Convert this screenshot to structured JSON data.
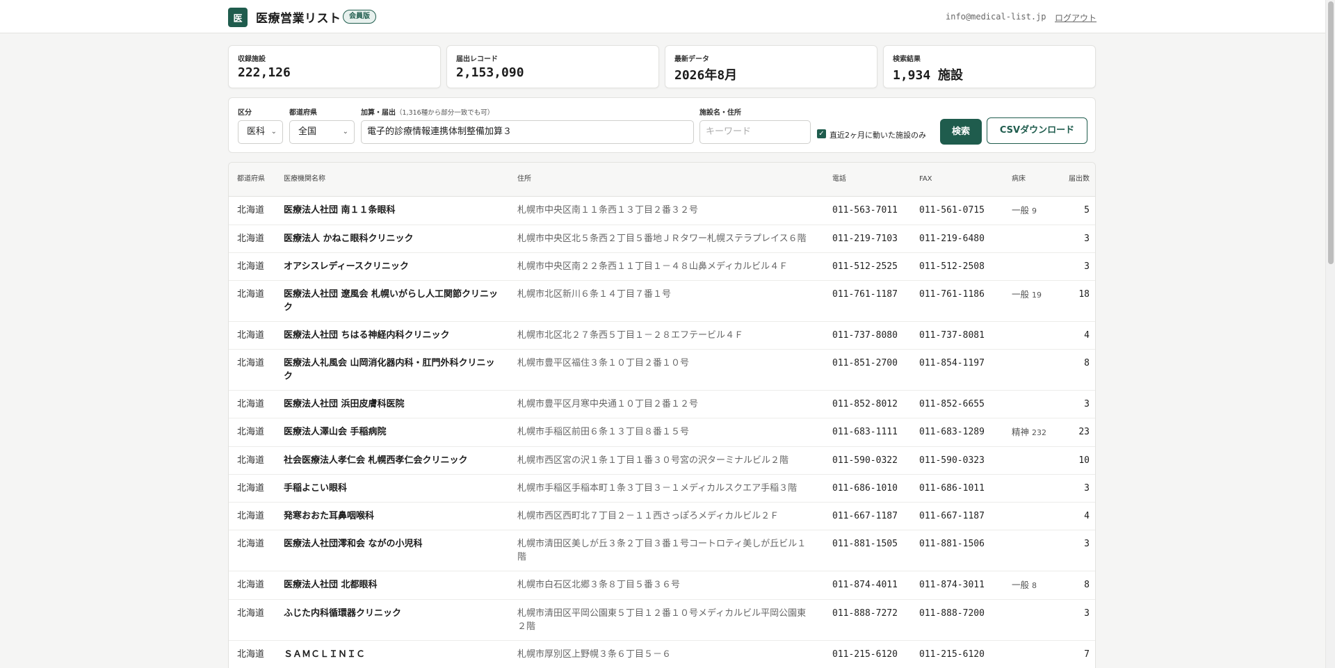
{
  "header": {
    "logo_glyph": "医",
    "title": "医療営業リスト",
    "badge": "会員版",
    "email": "info@medical-list.jp",
    "logout": "ログアウト"
  },
  "stats": [
    {
      "label": "収録施設",
      "value": "222,126"
    },
    {
      "label": "届出レコード",
      "value": "2,153,090"
    },
    {
      "label": "最新データ",
      "value": "2026年8月"
    },
    {
      "label": "検索結果",
      "value": "1,934 施設"
    }
  ],
  "filters": {
    "category_label": "区分",
    "category_value": "医科",
    "prefecture_label": "都道府県",
    "prefecture_value": "全国",
    "addition_label": "加算・届出",
    "addition_hint": "（1,316種から部分一致でも可）",
    "addition_value": "電子的診療情報連携体制整備加算３",
    "keyword_label": "施設名・住所",
    "keyword_placeholder": "キーワード",
    "recent_only_label": "直近2ヶ月に動いた施設のみ",
    "recent_only_checked": true,
    "search_button": "検索",
    "csv_button": "CSVダウンロード"
  },
  "table": {
    "headers": {
      "pref": "都道府県",
      "name": "医療機関名称",
      "address": "住所",
      "tel": "電話",
      "fax": "FAX",
      "beds": "病床",
      "count": "届出数"
    },
    "rows": [
      {
        "pref": "北海道",
        "name": "医療法人社団 南１１条眼科",
        "address": "札幌市中央区南１１条西１３丁目２番３２号",
        "tel": "011-563-7011",
        "fax": "011-561-0715",
        "bed_type": "一般",
        "bed_num": "9",
        "count": "5"
      },
      {
        "pref": "北海道",
        "name": "医療法人 かねこ眼科クリニック",
        "address": "札幌市中央区北５条西２丁目５番地ＪＲタワー札幌ステラプレイス６階",
        "tel": "011-219-7103",
        "fax": "011-219-6480",
        "bed_type": "",
        "bed_num": "",
        "count": "3"
      },
      {
        "pref": "北海道",
        "name": "オアシスレディースクリニック",
        "address": "札幌市中央区南２２条西１１丁目１－４８山鼻メディカルビル４Ｆ",
        "tel": "011-512-2525",
        "fax": "011-512-2508",
        "bed_type": "",
        "bed_num": "",
        "count": "3"
      },
      {
        "pref": "北海道",
        "name": "医療法人社団 遼風会 札幌いがらし人工関節クリニック",
        "address": "札幌市北区新川６条１４丁目７番１号",
        "tel": "011-761-1187",
        "fax": "011-761-1186",
        "bed_type": "一般",
        "bed_num": "19",
        "count": "18"
      },
      {
        "pref": "北海道",
        "name": "医療法人社団 ちはる神経内科クリニック",
        "address": "札幌市北区北２７条西５丁目１－２８エフテービル４Ｆ",
        "tel": "011-737-8080",
        "fax": "011-737-8081",
        "bed_type": "",
        "bed_num": "",
        "count": "4"
      },
      {
        "pref": "北海道",
        "name": "医療法人礼風会 山岡消化器内科・肛門外科クリニック",
        "address": "札幌市豊平区福住３条１０丁目２番１０号",
        "tel": "011-851-2700",
        "fax": "011-854-1197",
        "bed_type": "",
        "bed_num": "",
        "count": "8"
      },
      {
        "pref": "北海道",
        "name": "医療法人社団 浜田皮膚科医院",
        "address": "札幌市豊平区月寒中央通１０丁目２番１２号",
        "tel": "011-852-8012",
        "fax": "011-852-6655",
        "bed_type": "",
        "bed_num": "",
        "count": "3"
      },
      {
        "pref": "北海道",
        "name": "医療法人澤山会 手稲病院",
        "address": "札幌市手稲区前田６条１３丁目８番１５号",
        "tel": "011-683-1111",
        "fax": "011-683-1289",
        "bed_type": "精神",
        "bed_num": "232",
        "count": "23"
      },
      {
        "pref": "北海道",
        "name": "社会医療法人孝仁会 札幌西孝仁会クリニック",
        "address": "札幌市西区宮の沢１条１丁目１番３０号宮の沢ターミナルビル２階",
        "tel": "011-590-0322",
        "fax": "011-590-0323",
        "bed_type": "",
        "bed_num": "",
        "count": "10"
      },
      {
        "pref": "北海道",
        "name": "手稲よこい眼科",
        "address": "札幌市手稲区手稲本町１条３丁目３－１メディカルスクエア手稲３階",
        "tel": "011-686-1010",
        "fax": "011-686-1011",
        "bed_type": "",
        "bed_num": "",
        "count": "3"
      },
      {
        "pref": "北海道",
        "name": "発寒おおた耳鼻咽喉科",
        "address": "札幌市西区西町北７丁目２－１１西さっぽろメディカルビル２Ｆ",
        "tel": "011-667-1187",
        "fax": "011-667-1187",
        "bed_type": "",
        "bed_num": "",
        "count": "4"
      },
      {
        "pref": "北海道",
        "name": "医療法人社団澪和会 ながの小児科",
        "address": "札幌市清田区美しが丘３条２丁目３番１号コートロティ美しが丘ビル１階",
        "tel": "011-881-1505",
        "fax": "011-881-1506",
        "bed_type": "",
        "bed_num": "",
        "count": "3"
      },
      {
        "pref": "北海道",
        "name": "医療法人社団 北都眼科",
        "address": "札幌市白石区北郷３条８丁目５番３６号",
        "tel": "011-874-4011",
        "fax": "011-874-3011",
        "bed_type": "一般",
        "bed_num": "8",
        "count": "8"
      },
      {
        "pref": "北海道",
        "name": "ふじた内科循環器クリニック",
        "address": "札幌市清田区平岡公園東５丁目１２番１０号メディカルビル平岡公園東２階",
        "tel": "011-888-7272",
        "fax": "011-888-7200",
        "bed_type": "",
        "bed_num": "",
        "count": "3"
      },
      {
        "pref": "北海道",
        "name": "ＳＡＭＣＬＩＮＩＣ",
        "address": "札幌市厚別区上野幌３条６丁目５－６",
        "tel": "011-215-6120",
        "fax": "011-215-6120",
        "bed_type": "",
        "bed_num": "",
        "count": "7"
      }
    ]
  }
}
